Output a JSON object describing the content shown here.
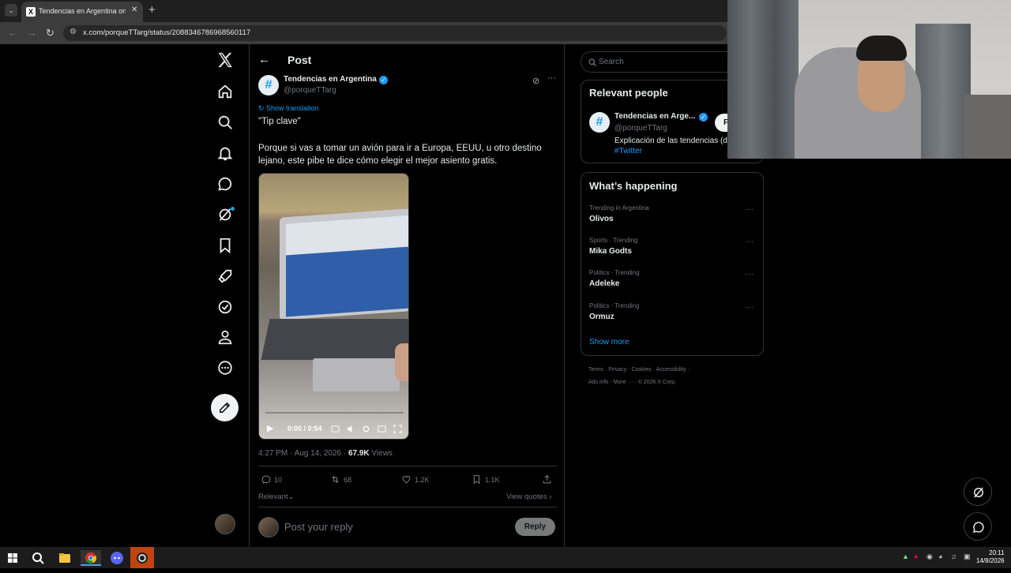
{
  "browser": {
    "tab_title": "Tendencias en Argentina on X: ",
    "tab_favicon": "X",
    "tab_close": "✕",
    "new_tab": "+",
    "tab_menu": "⌄",
    "url": "x.com/porqueTTarg/status/2088346786968560117"
  },
  "post": {
    "header_title": "Post",
    "author_name": "Tendencias en Argentina",
    "author_handle": "@porqueTTarg",
    "avatar_glyph": "#",
    "show_translation": "Show translation",
    "quote_line": "\"Tip clave\"",
    "body": "Porque si vas a tomar un avión para ir a Europa, EEUU, u otro destino lejano, este pibe te dice cómo elegir el mejor asiento gratis.",
    "video_time": "0:00 / 0:54",
    "timestamp": "4:27 PM · Aug 14, 2026 · ",
    "views_count": "67.9K",
    "views_label": " Views",
    "replies": "10",
    "reposts": "68",
    "likes": "1.2K",
    "bookmarks": "1.1K",
    "relevant_label": "Relevant",
    "view_quotes": "View quotes",
    "reply_placeholder": "Post your reply",
    "reply_button": "Reply"
  },
  "sidebar": {
    "search_placeholder": "Search",
    "relevant_people_title": "Relevant people",
    "rp_name": "Tendencias en Arge...",
    "rp_handle": "@porqueTTarg",
    "rp_follow": "Follow",
    "rp_bio": "Explicación de las tendencias (de Argentina)",
    "rp_tag": "#Twitter",
    "happening_title": "What’s happening",
    "trends": [
      {
        "meta": "Trending in Argentina",
        "name": "Olivos"
      },
      {
        "meta": "Sports · Trending",
        "name": "Mika Godts"
      },
      {
        "meta": "Politics · Trending",
        "name": "Adeleke"
      },
      {
        "meta": "Politics · Trending",
        "name": "Ormuz"
      }
    ],
    "show_more": "Show more",
    "footer_line1": "Terms  ·  Privacy  ·  Cookies  ·  Accessibility  ·",
    "footer_line2": "Ads info  ·  More ···  ·  © 2026 X Corp."
  },
  "taskbar": {
    "clock_time": "20:11",
    "clock_date": "14/8/2026"
  },
  "colors": {
    "accent": "#1d9bf0",
    "background": "#000000",
    "border": "#2f3336",
    "muted_text": "#71767b"
  }
}
